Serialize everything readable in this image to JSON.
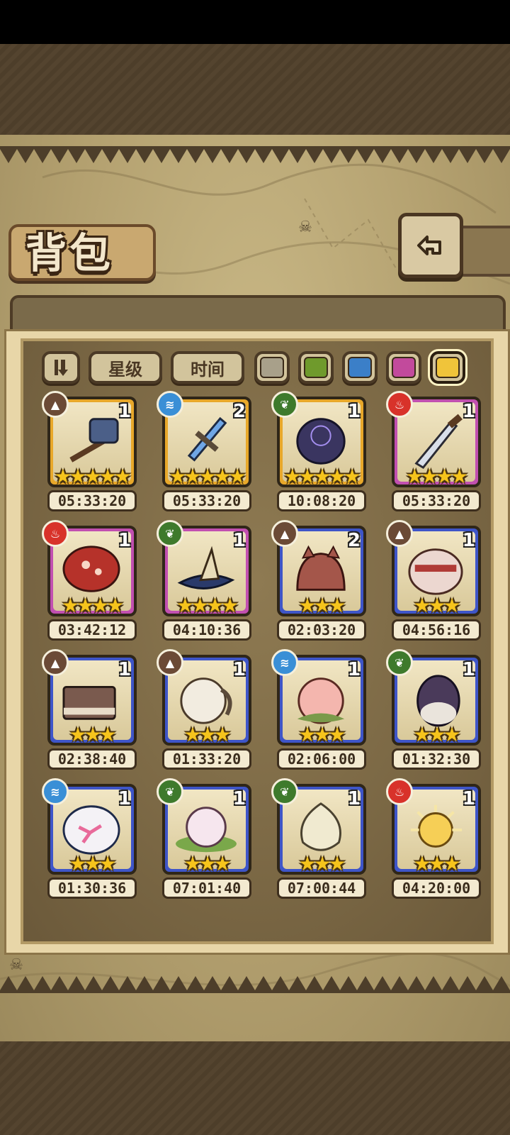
{
  "title": "背包",
  "filters": {
    "sort_label": "",
    "star_label": "星级",
    "time_label": "时间",
    "swatches": [
      {
        "name": "gray",
        "color": "#a8a08a"
      },
      {
        "name": "green",
        "color": "#6f9a2c"
      },
      {
        "name": "blue",
        "color": "#3b7fc8"
      },
      {
        "name": "purple",
        "color": "#c24a9c"
      },
      {
        "name": "yellow",
        "color": "#f0c43a"
      }
    ]
  },
  "rarity_colors": {
    "gold": "#e8a82a",
    "purple": "#c14fb0",
    "blue": "#3e55c8"
  },
  "element_colors": {
    "earth": "#6b4a36",
    "water": "#3a8fd6",
    "nature": "#3e7a2c",
    "fire": "#d8322a"
  },
  "items": [
    {
      "name": "hammer",
      "element": "earth",
      "rarity": "gold",
      "count": "1",
      "stars": "★★★★★",
      "time": "05:33:20"
    },
    {
      "name": "blue-sword",
      "element": "water",
      "rarity": "gold",
      "count": "2",
      "stars": "★★★★★",
      "time": "05:33:20"
    },
    {
      "name": "dark-orb",
      "element": "nature",
      "rarity": "gold",
      "count": "1",
      "stars": "★★★★★",
      "time": "10:08:20"
    },
    {
      "name": "dagger",
      "element": "fire",
      "rarity": "purple",
      "count": "1",
      "stars": "★★★★",
      "time": "05:33:20"
    },
    {
      "name": "red-mushroom",
      "element": "fire",
      "rarity": "purple",
      "count": "1",
      "stars": "★★★★",
      "time": "03:42:12"
    },
    {
      "name": "witch-hat",
      "element": "nature",
      "rarity": "purple",
      "count": "1",
      "stars": "★★★★",
      "time": "04:10:36"
    },
    {
      "name": "cat-hood",
      "element": "earth",
      "rarity": "blue",
      "count": "2",
      "stars": "★★★",
      "time": "02:03:20"
    },
    {
      "name": "bow-bonnet",
      "element": "earth",
      "rarity": "blue",
      "count": "1",
      "stars": "★★★",
      "time": "04:56:16"
    },
    {
      "name": "book",
      "element": "earth",
      "rarity": "blue",
      "count": "1",
      "stars": "★★★",
      "time": "02:38:40"
    },
    {
      "name": "wool-horn",
      "element": "earth",
      "rarity": "blue",
      "count": "1",
      "stars": "★★★",
      "time": "01:33:20"
    },
    {
      "name": "peach",
      "element": "water",
      "rarity": "blue",
      "count": "1",
      "stars": "★★★",
      "time": "02:06:00"
    },
    {
      "name": "purple-egg",
      "element": "nature",
      "rarity": "blue",
      "count": "1",
      "stars": "★★★",
      "time": "01:32:30"
    },
    {
      "name": "sakura-cloth",
      "element": "water",
      "rarity": "blue",
      "count": "1",
      "stars": "★★★",
      "time": "01:30:36"
    },
    {
      "name": "lotus-pearl",
      "element": "nature",
      "rarity": "blue",
      "count": "1",
      "stars": "★★★",
      "time": "07:01:40"
    },
    {
      "name": "white-bud",
      "element": "nature",
      "rarity": "blue",
      "count": "1",
      "stars": "★★★",
      "time": "07:00:44"
    },
    {
      "name": "sun-orb",
      "element": "fire",
      "rarity": "blue",
      "count": "1",
      "stars": "★★★",
      "time": "04:20:00"
    }
  ]
}
